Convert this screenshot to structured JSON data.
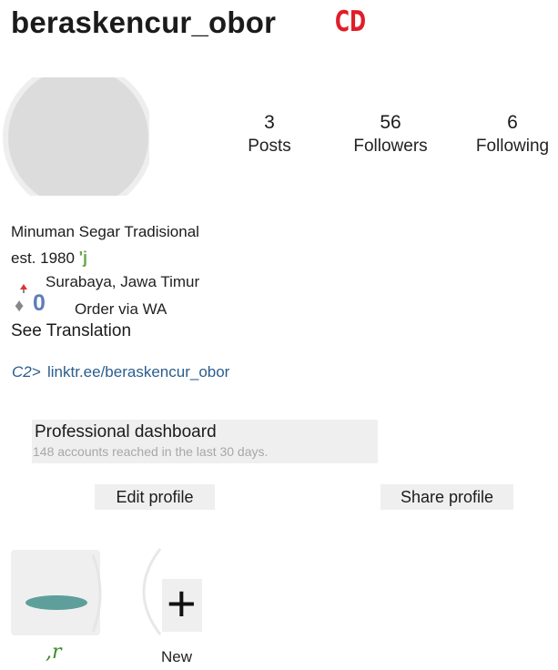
{
  "profile": {
    "username": "beraskencur_obor",
    "badge_text": "CD",
    "badge_color": "#e11d2a"
  },
  "stats": [
    {
      "value": "3",
      "label": "Posts"
    },
    {
      "value": "56",
      "label": "Followers"
    },
    {
      "value": "6",
      "label": "Following"
    }
  ],
  "bio": {
    "name": "Minuman Segar Tradisional",
    "est": "est. 1980",
    "est_emoji": "'j",
    "location": "Surabaya, Jawa Timur",
    "diamond": "♦",
    "zero": "0",
    "order": "Order via WA",
    "see_translation": "See Translation",
    "link_icon": "C2>",
    "link": "linktr.ee/beraskencur_obor"
  },
  "dashboard": {
    "title": "Professional dashboard",
    "subtitle": "148 accounts reached in the last 30 days."
  },
  "buttons": {
    "edit": "Edit profile",
    "share": "Share profile"
  },
  "highlights": [
    {
      "label": ",r"
    },
    {
      "label": "New",
      "icon": "plus-icon"
    }
  ],
  "colors": {
    "link": "#2b5d8c",
    "highlight_ellipse": "#5e9f9b"
  }
}
